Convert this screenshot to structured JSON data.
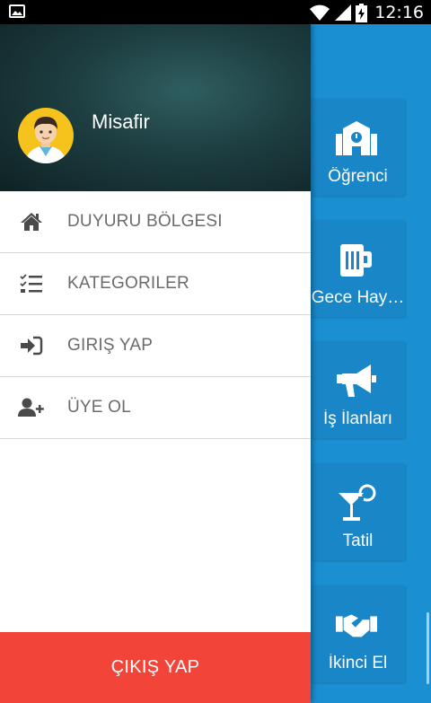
{
  "status_bar": {
    "time": "12:16",
    "icons": [
      "image-icon",
      "wifi-icon",
      "signal-icon",
      "battery-charging-icon"
    ]
  },
  "drawer": {
    "user": {
      "name": "Misafir",
      "avatar_icon": "user-avatar-icon",
      "avatar_color": "#f6c21c"
    },
    "menu": [
      {
        "label": "DUYURU BÖLGESI",
        "icon": "home-icon"
      },
      {
        "label": "KATEGORILER",
        "icon": "checklist-icon"
      },
      {
        "label": "GIRIŞ YAP",
        "icon": "sign-in-icon"
      },
      {
        "label": "ÜYE OL",
        "icon": "user-plus-icon"
      }
    ],
    "logout_label": "ÇIKIŞ YAP",
    "logout_color": "#f3443a"
  },
  "categories": [
    {
      "label": "Öğrenci",
      "icon": "school-icon"
    },
    {
      "label": "Gece Hay…",
      "icon": "beer-mug-icon"
    },
    {
      "label": "İş İlanları",
      "icon": "megaphone-icon"
    },
    {
      "label": "Tatil",
      "icon": "cocktail-icon"
    },
    {
      "label": "İkinci El",
      "icon": "handshake-icon"
    }
  ],
  "colors": {
    "accent": "#1a8fd1",
    "tile": "#1986c7"
  }
}
